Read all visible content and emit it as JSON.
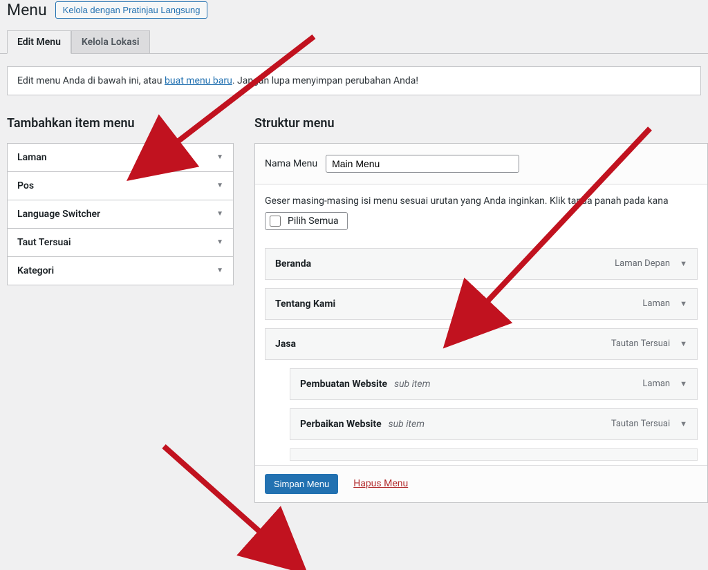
{
  "header": {
    "page_title": "Menu",
    "manage_btn": "Kelola dengan Pratinjau Langsung"
  },
  "tabs": {
    "edit": "Edit Menu",
    "locations": "Kelola Lokasi"
  },
  "notice": {
    "prefix": "Edit menu Anda di bawah ini, atau ",
    "link": "buat menu baru",
    "suffix": ". Jangan lupa menyimpan perubahan Anda!"
  },
  "add_items": {
    "heading": "Tambahkan item menu",
    "panels": {
      "pages": "Laman",
      "posts": "Pos",
      "lang": "Language Switcher",
      "custom": "Taut Tersuai",
      "categories": "Kategori"
    }
  },
  "structure": {
    "heading": "Struktur menu",
    "name_label": "Nama Menu",
    "name_value": "Main Menu",
    "instructions": "Geser masing-masing isi menu sesuai urutan yang Anda inginkan. Klik tanda panah pada kana",
    "select_all": "Pilih Semua",
    "sub_item": "sub item",
    "items": [
      {
        "title": "Beranda",
        "type": "Laman Depan",
        "indent": false,
        "sub": false
      },
      {
        "title": "Tentang Kami",
        "type": "Laman",
        "indent": false,
        "sub": false
      },
      {
        "title": "Jasa",
        "type": "Tautan Tersuai",
        "indent": false,
        "sub": false
      },
      {
        "title": "Pembuatan Website",
        "type": "Laman",
        "indent": true,
        "sub": true
      },
      {
        "title": "Perbaikan Website",
        "type": "Tautan Tersuai",
        "indent": true,
        "sub": true
      }
    ]
  },
  "footer": {
    "save": "Simpan Menu",
    "delete": "Hapus Menu"
  }
}
